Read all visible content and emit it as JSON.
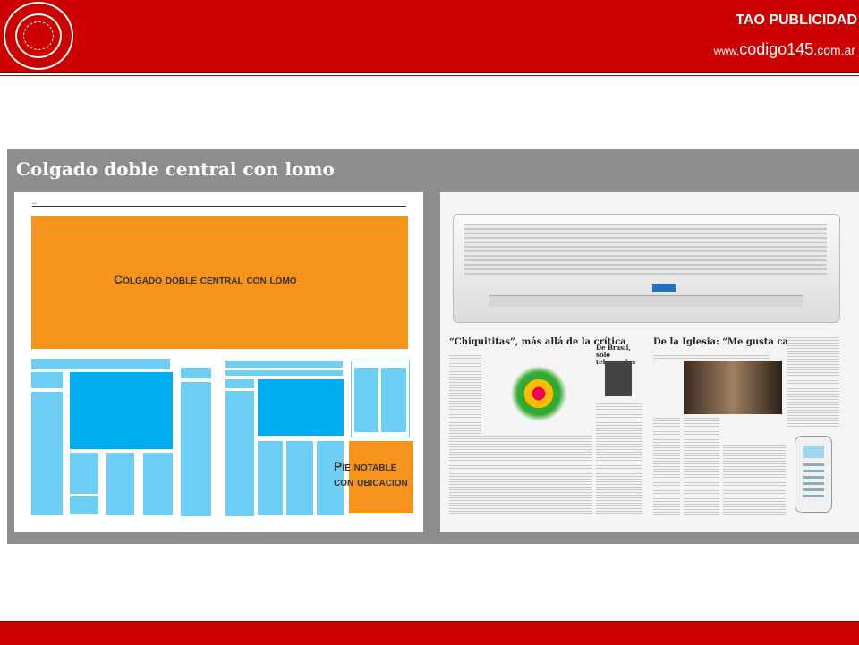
{
  "header": {
    "agency": "TAO PUBLICIDAD",
    "site_www": "www.",
    "site_domain": "codigo145",
    "site_tld": ".com.ar"
  },
  "slide": {
    "title": "Colgado doble central con lomo",
    "left_page": {
      "main_label": "Colgado doble central con lomo",
      "pie_line1": "Pie notable",
      "pie_line2": "con ubicacion"
    },
    "right_page": {
      "headline1": "“Chiquititas”, más allá de la crítica",
      "headline2": "De Brasil, sólo telenovelas",
      "headline3": "De la Iglesia: “Me gusta cambiar”"
    }
  },
  "colors": {
    "header_red": "#cc0000",
    "slide_gray": "#8d8d8d",
    "ad_orange": "#f7941d",
    "light_blue": "#6dcff6",
    "dark_blue": "#00aeef"
  },
  "icons": [
    "university-seal-icon",
    "air-conditioner-image",
    "remote-control-image"
  ]
}
